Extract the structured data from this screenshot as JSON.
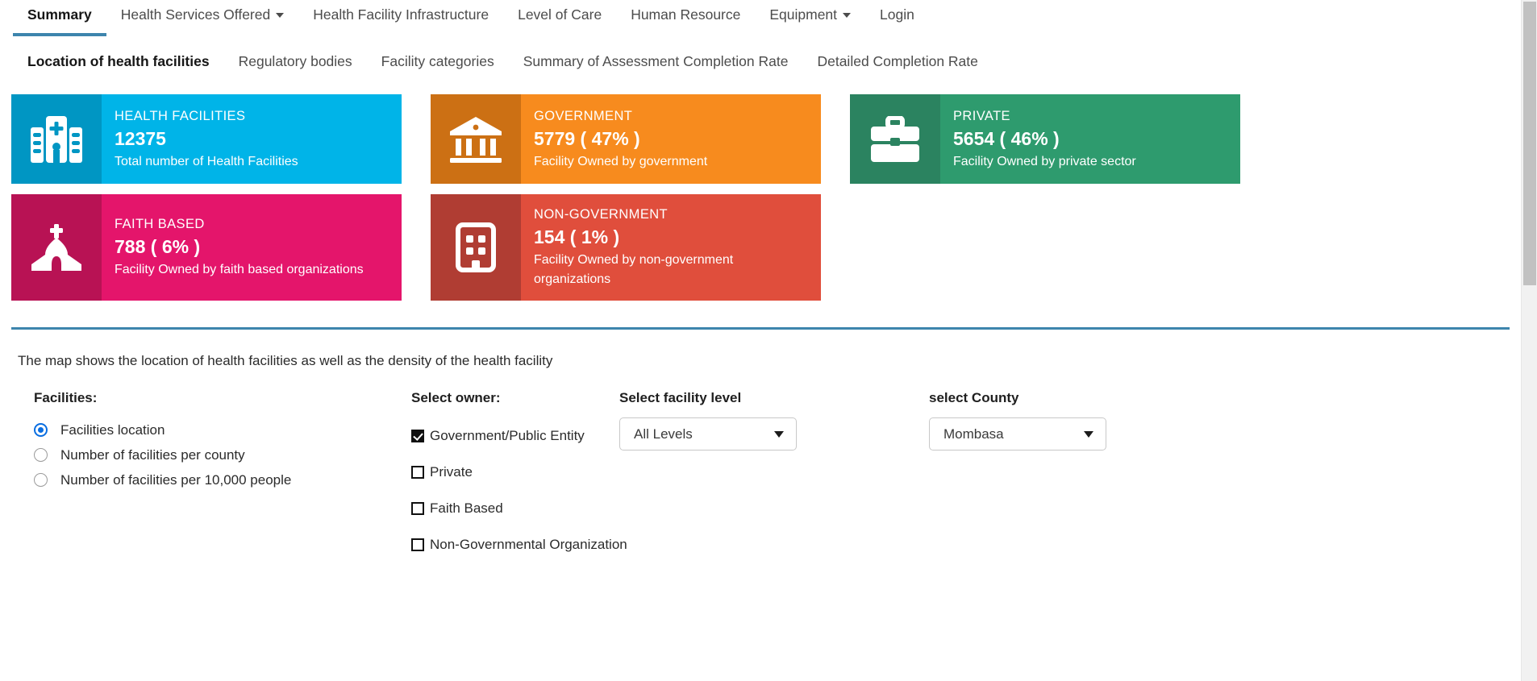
{
  "mainnav": {
    "items": [
      {
        "label": "Summary",
        "active": true,
        "caret": false
      },
      {
        "label": "Health Services Offered",
        "active": false,
        "caret": true
      },
      {
        "label": "Health Facility Infrastructure",
        "active": false,
        "caret": false
      },
      {
        "label": "Level of Care",
        "active": false,
        "caret": false
      },
      {
        "label": "Human Resource",
        "active": false,
        "caret": false
      },
      {
        "label": "Equipment",
        "active": false,
        "caret": true
      },
      {
        "label": "Login",
        "active": false,
        "caret": false
      }
    ]
  },
  "subnav": {
    "items": [
      {
        "label": "Location of health facilities",
        "active": true
      },
      {
        "label": "Regulatory bodies",
        "active": false
      },
      {
        "label": "Facility categories",
        "active": false
      },
      {
        "label": "Summary of Assessment Completion Rate",
        "active": false
      },
      {
        "label": "Detailed Completion Rate",
        "active": false
      }
    ]
  },
  "cards": [
    {
      "id": "health-facilities",
      "title": "HEALTH FACILITIES",
      "value": "12375",
      "desc": "Total number of Health Facilities",
      "icon": "hospital-icon",
      "body_color": "#00b4e8",
      "icon_color": "#0096c3"
    },
    {
      "id": "government",
      "title": "GOVERNMENT",
      "value": "5779 ( 47% )",
      "desc": "Facility Owned by government",
      "icon": "bank-icon",
      "body_color": "#f78b1e",
      "icon_color": "#cc7014"
    },
    {
      "id": "private",
      "title": "PRIVATE",
      "value": "5654 ( 46% )",
      "desc": "Facility Owned by private sector",
      "icon": "briefcase-icon",
      "body_color": "#2e9b6e",
      "icon_color": "#2b8360"
    },
    {
      "id": "faith-based",
      "title": "FAITH BASED",
      "value": "788 ( 6% )",
      "desc": "Facility Owned by faith based organizations",
      "icon": "church-icon",
      "body_color": "#e4156b",
      "icon_color": "#b81254"
    },
    {
      "id": "non-government",
      "title": "NON-GOVERNMENT",
      "value": "154 ( 1% )",
      "desc": "Facility Owned by non-government organizations",
      "icon": "office-building-icon",
      "body_color": "#e04e3c",
      "icon_color": "#b03d33"
    }
  ],
  "map": {
    "note": "The map shows the location of health facilities as well as the density of the health facility"
  },
  "facilities": {
    "label": "Facilities:",
    "options": [
      {
        "label": "Facilities location",
        "checked": true
      },
      {
        "label": "Number of facilities per county",
        "checked": false
      },
      {
        "label": "Number of facilities per 10,000 people",
        "checked": false
      }
    ]
  },
  "owner": {
    "label": "Select owner:",
    "options": [
      {
        "label": "Government/Public Entity",
        "checked": true
      },
      {
        "label": "Private",
        "checked": false
      },
      {
        "label": "Faith Based",
        "checked": false
      },
      {
        "label": "Non-Governmental Organization",
        "checked": false
      }
    ]
  },
  "facility_level": {
    "label": "Select facility level",
    "value": "All Levels"
  },
  "county": {
    "label": "select County",
    "value": "Mombasa"
  },
  "theme": {
    "accent": "#3d85ad",
    "radio_accent": "#0a6ee1"
  }
}
